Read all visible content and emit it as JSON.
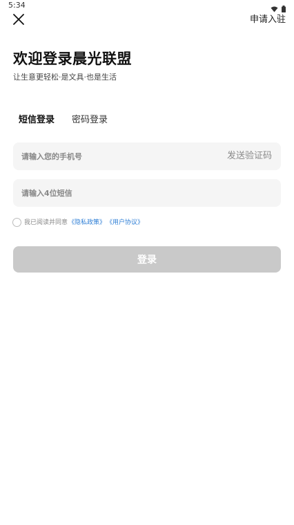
{
  "status_bar": {
    "time": "5:34",
    "icons": [
      "wifi-icon",
      "battery-icon"
    ]
  },
  "header": {
    "close_icon": "close-icon",
    "apply_label": "申请入驻"
  },
  "hero": {
    "title": "欢迎登录晨光联盟",
    "subtitle": "让生意更轻松·是文具·也是生活"
  },
  "tabs": [
    {
      "label": "短信登录",
      "active": true
    },
    {
      "label": "密码登录",
      "active": false
    }
  ],
  "form": {
    "phone_placeholder": "请输入您的手机号",
    "send_code_label": "发送验证码",
    "code_placeholder": "请输入4位短信",
    "agree_text": "我已阅读并同意",
    "privacy_link": "《隐私政策》",
    "user_link": "《用户协议》",
    "agree_checked": false,
    "login_label": "登录"
  },
  "colors": {
    "accent_underline": "#f5d000",
    "link": "#2f7fd6",
    "disabled_button": "#c9c9c9",
    "input_bg": "#f5f5f5"
  }
}
